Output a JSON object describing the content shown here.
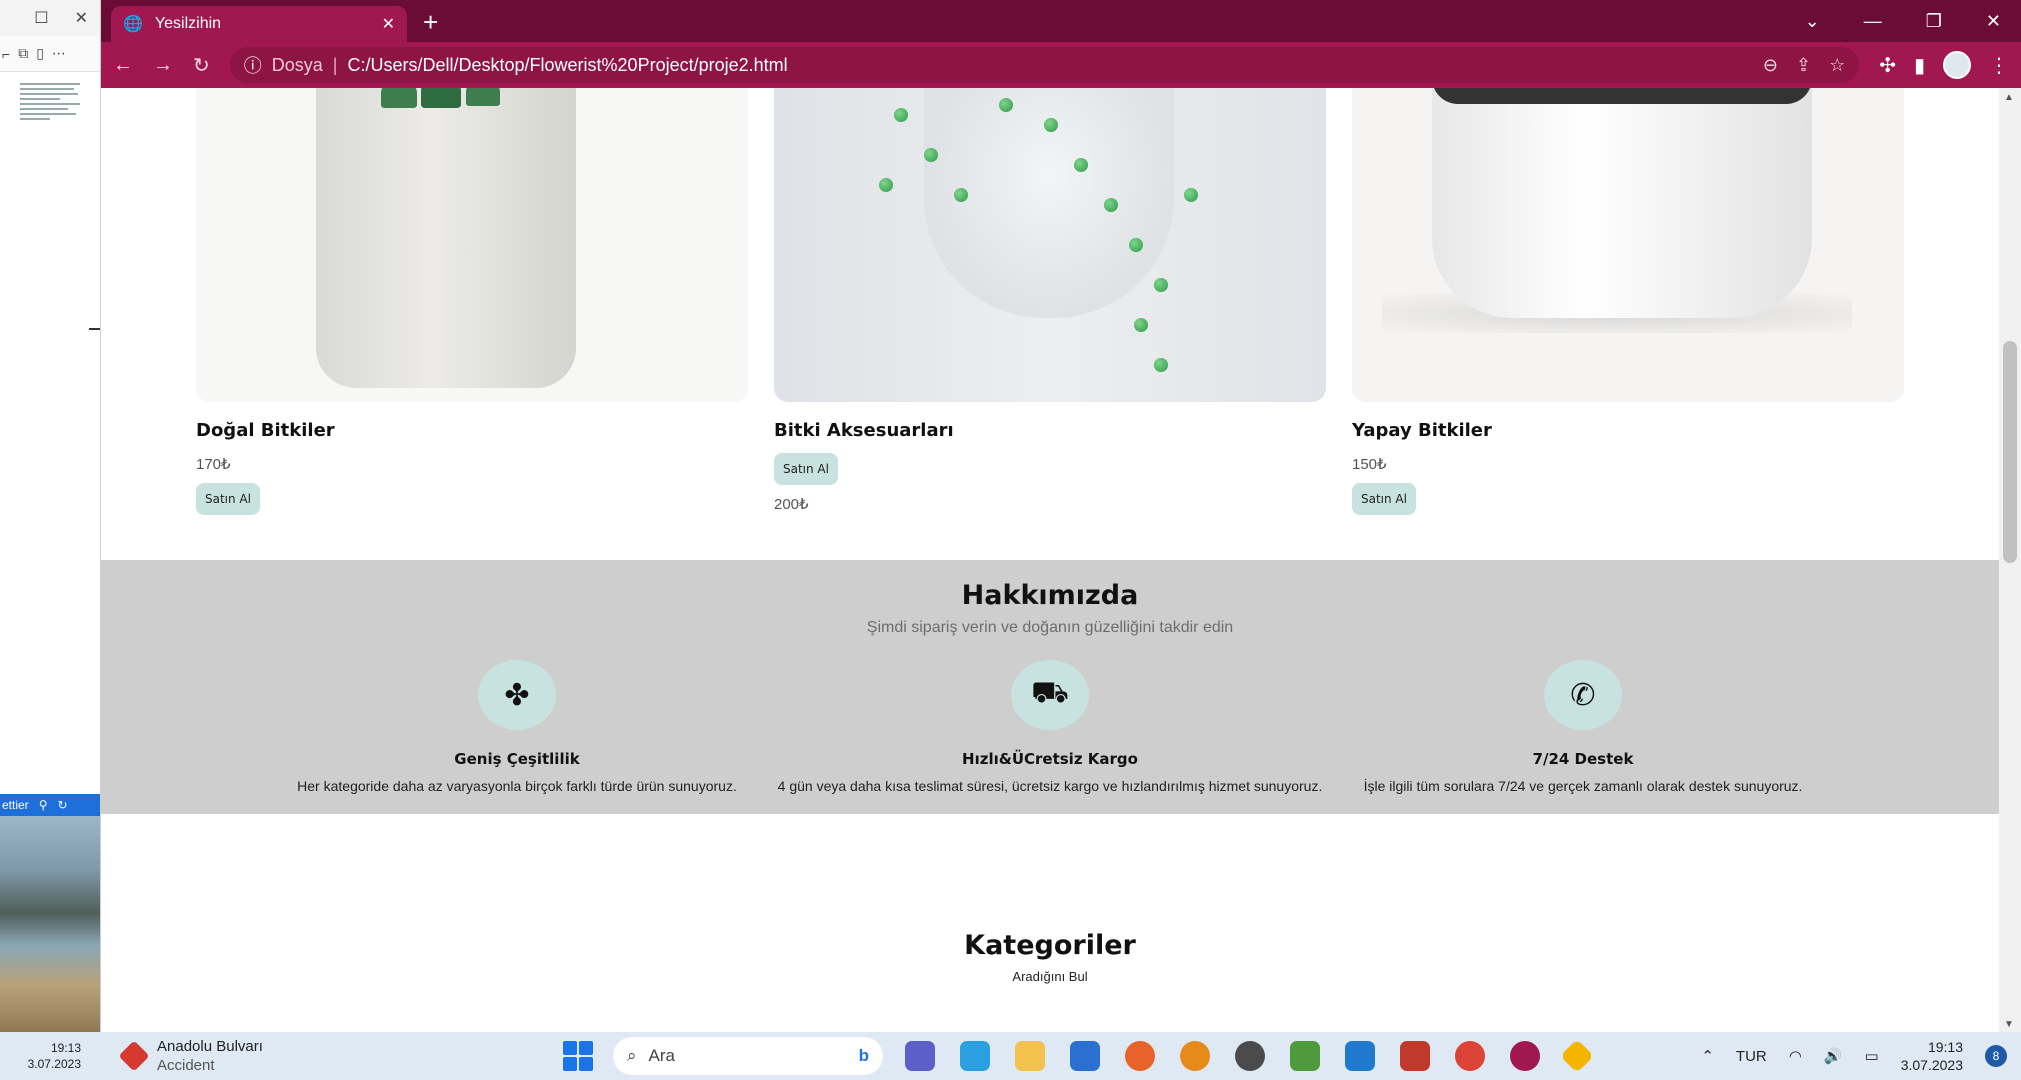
{
  "left_window": {
    "toolbar_icons": [
      "window-maximize-icon",
      "window-close-icon"
    ],
    "blue_bar_label": "ettier"
  },
  "browser": {
    "tab_title": "Yesilzihin",
    "new_tab_symbol": "+",
    "address": {
      "security_label": "Dosya",
      "url": "C:/Users/Dell/Desktop/Flowerist%20Project/proje2.html"
    }
  },
  "products": [
    {
      "name": "Doğal Bitkiler",
      "price": "170₺",
      "button": "Satın Al"
    },
    {
      "name": "Bitki Aksesuarları",
      "price": "200₺",
      "button": "Satın Al"
    },
    {
      "name": "Yapay Bitkiler",
      "price": "150₺",
      "button": "Satın Al"
    }
  ],
  "about": {
    "title": "Hakkımızda",
    "subtitle": "Şimdi sipariş verin ve doğanın güzelliğini takdir edin",
    "features": [
      {
        "icon": "clover-icon",
        "title": "Geniş Çeşitlilik",
        "text": "Her kategoride daha az varyasyonla birçok farklı türde ürün sunuyoruz."
      },
      {
        "icon": "truck-icon",
        "title": "Hızlı&ÜCretsiz Kargo",
        "text": "4 gün veya daha kısa teslimat süresi, ücretsiz kargo ve hızlandırılmış hizmet sunuyoruz."
      },
      {
        "icon": "phone-icon",
        "title": "7/24 Destek",
        "text": "İşle ilgili tüm sorulara 7/24 ve gerçek zamanlı olarak destek sunuyoruz."
      }
    ]
  },
  "categories": {
    "title": "Kategoriler",
    "subtitle": "Aradığını Bul"
  },
  "taskbar": {
    "left_time": "19:13",
    "left_date": "3.07.2023",
    "weather_title": "Anadolu Bulvarı",
    "weather_sub": "Accident",
    "search_placeholder": "Ara",
    "language": "TUR",
    "time": "19:13",
    "date": "3.07.2023",
    "notification_count": "8"
  },
  "colors": {
    "tab_bar": "#6b0c36",
    "address_bar": "#a1174f",
    "accent_button": "#c8e2df",
    "about_bg": "#cecece"
  }
}
